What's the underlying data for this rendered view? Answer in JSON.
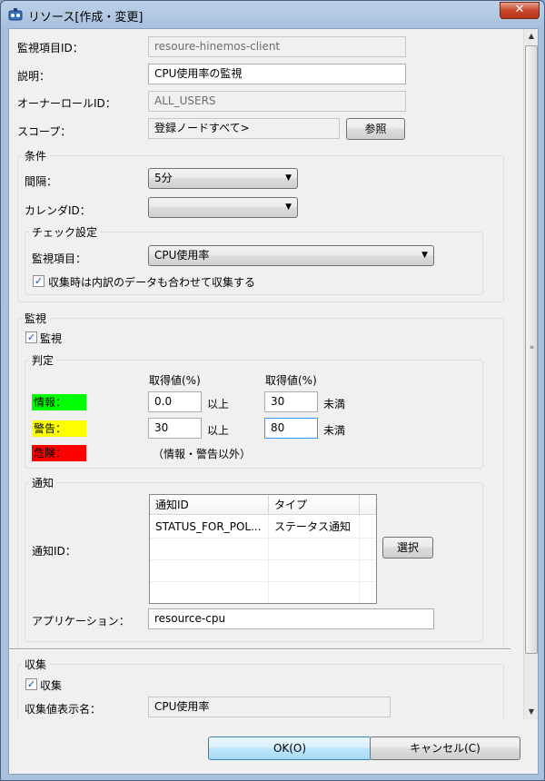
{
  "window": {
    "title": "リソース[作成・変更]",
    "close_label": "✕"
  },
  "form": {
    "monitor_id_label": "監視項目ID：",
    "monitor_id_value": "resoure-hinemos-client",
    "description_label": "説明：",
    "description_value": "CPU使用率の監視",
    "owner_role_label": "オーナーロールID：",
    "owner_role_value": "ALL_USERS",
    "scope_label": "スコープ：",
    "scope_value": "登録ノードすべて>",
    "scope_button": "参照"
  },
  "conditions": {
    "title": "条件",
    "interval_label": "間隔：",
    "interval_value": "5分",
    "calendar_label": "カレンダID：",
    "calendar_value": "",
    "check": {
      "title": "チェック設定",
      "item_label": "監視項目：",
      "item_value": "CPU使用率",
      "breakdown_label": "収集時は内訳のデータも合わせて収集する"
    }
  },
  "monitor": {
    "title": "監視",
    "enable_label": "監視",
    "judge": {
      "title": "判定",
      "col1": "取得値(%)",
      "col2": "取得値(%)",
      "rows": [
        {
          "label": "情報：",
          "color": "#00ff00",
          "lower": "0.0",
          "lower_suffix": "以上",
          "upper": "30",
          "upper_suffix": "未満"
        },
        {
          "label": "警告：",
          "color": "#ffff00",
          "lower": "30",
          "lower_suffix": "以上",
          "upper": "80",
          "upper_suffix": "未満"
        },
        {
          "label": "危険：",
          "color": "#ff0000",
          "note": "（情報・警告以外）"
        }
      ]
    },
    "notify": {
      "title": "通知",
      "id_label": "通知ID：",
      "columns": [
        "通知ID",
        "タイプ"
      ],
      "rows": [
        {
          "id": "STATUS_FOR_POL...",
          "type": "ステータス通知"
        }
      ],
      "select_button": "選択",
      "app_label": "アプリケーション：",
      "app_value": "resource-cpu"
    }
  },
  "collect": {
    "title": "収集",
    "enable_label": "収集",
    "display_name_label": "収集値表示名：",
    "display_name_value": "CPU使用率"
  },
  "footer": {
    "ok": "OK(O)",
    "cancel": "キャンセル(C)"
  }
}
